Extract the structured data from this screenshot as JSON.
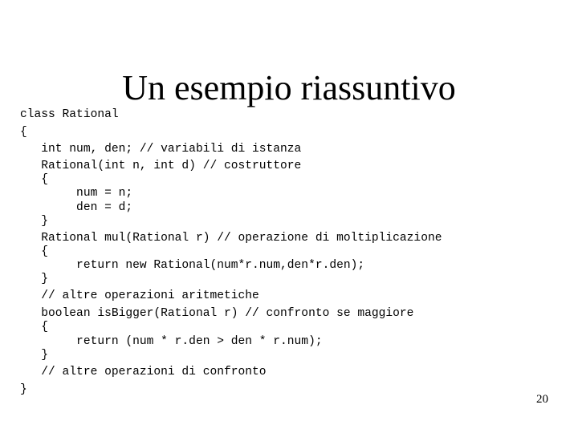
{
  "slide": {
    "title": "Un esempio riassuntivo",
    "page_number": "20",
    "code_lines": [
      "class Rational",
      "{",
      "   int num, den; // variabili di istanza",
      "   Rational(int n, int d) // costruttore",
      "   {",
      "        num = n;",
      "        den = d;",
      "   }",
      "   Rational mul(Rational r) // operazione di moltiplicazione",
      "   {",
      "        return new Rational(num*r.num,den*r.den);",
      "   }",
      "   // altre operazioni aritmetiche",
      "   boolean isBigger(Rational r) // confronto se maggiore",
      "   {",
      "        return (num * r.den > den * r.num);",
      "   }",
      "   // altre operazioni di confronto",
      "}"
    ]
  }
}
